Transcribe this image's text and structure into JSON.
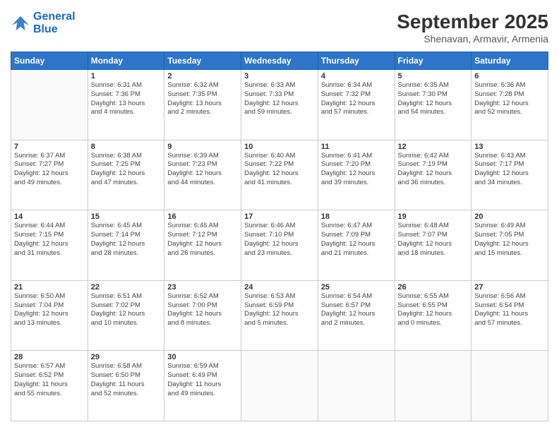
{
  "header": {
    "logo_line1": "General",
    "logo_line2": "Blue",
    "month": "September 2025",
    "location": "Shenavan, Armavir, Armenia"
  },
  "weekdays": [
    "Sunday",
    "Monday",
    "Tuesday",
    "Wednesday",
    "Thursday",
    "Friday",
    "Saturday"
  ],
  "weeks": [
    [
      {
        "day": "",
        "info": ""
      },
      {
        "day": "1",
        "info": "Sunrise: 6:31 AM\nSunset: 7:36 PM\nDaylight: 13 hours\nand 4 minutes."
      },
      {
        "day": "2",
        "info": "Sunrise: 6:32 AM\nSunset: 7:35 PM\nDaylight: 13 hours\nand 2 minutes."
      },
      {
        "day": "3",
        "info": "Sunrise: 6:33 AM\nSunset: 7:33 PM\nDaylight: 12 hours\nand 59 minutes."
      },
      {
        "day": "4",
        "info": "Sunrise: 6:34 AM\nSunset: 7:32 PM\nDaylight: 12 hours\nand 57 minutes."
      },
      {
        "day": "5",
        "info": "Sunrise: 6:35 AM\nSunset: 7:30 PM\nDaylight: 12 hours\nand 54 minutes."
      },
      {
        "day": "6",
        "info": "Sunrise: 6:36 AM\nSunset: 7:28 PM\nDaylight: 12 hours\nand 52 minutes."
      }
    ],
    [
      {
        "day": "7",
        "info": "Sunrise: 6:37 AM\nSunset: 7:27 PM\nDaylight: 12 hours\nand 49 minutes."
      },
      {
        "day": "8",
        "info": "Sunrise: 6:38 AM\nSunset: 7:25 PM\nDaylight: 12 hours\nand 47 minutes."
      },
      {
        "day": "9",
        "info": "Sunrise: 6:39 AM\nSunset: 7:23 PM\nDaylight: 12 hours\nand 44 minutes."
      },
      {
        "day": "10",
        "info": "Sunrise: 6:40 AM\nSunset: 7:22 PM\nDaylight: 12 hours\nand 41 minutes."
      },
      {
        "day": "11",
        "info": "Sunrise: 6:41 AM\nSunset: 7:20 PM\nDaylight: 12 hours\nand 39 minutes."
      },
      {
        "day": "12",
        "info": "Sunrise: 6:42 AM\nSunset: 7:19 PM\nDaylight: 12 hours\nand 36 minutes."
      },
      {
        "day": "13",
        "info": "Sunrise: 6:43 AM\nSunset: 7:17 PM\nDaylight: 12 hours\nand 34 minutes."
      }
    ],
    [
      {
        "day": "14",
        "info": "Sunrise: 6:44 AM\nSunset: 7:15 PM\nDaylight: 12 hours\nand 31 minutes."
      },
      {
        "day": "15",
        "info": "Sunrise: 6:45 AM\nSunset: 7:14 PM\nDaylight: 12 hours\nand 28 minutes."
      },
      {
        "day": "16",
        "info": "Sunrise: 6:46 AM\nSunset: 7:12 PM\nDaylight: 12 hours\nand 26 minutes."
      },
      {
        "day": "17",
        "info": "Sunrise: 6:46 AM\nSunset: 7:10 PM\nDaylight: 12 hours\nand 23 minutes."
      },
      {
        "day": "18",
        "info": "Sunrise: 6:47 AM\nSunset: 7:09 PM\nDaylight: 12 hours\nand 21 minutes."
      },
      {
        "day": "19",
        "info": "Sunrise: 6:48 AM\nSunset: 7:07 PM\nDaylight: 12 hours\nand 18 minutes."
      },
      {
        "day": "20",
        "info": "Sunrise: 6:49 AM\nSunset: 7:05 PM\nDaylight: 12 hours\nand 15 minutes."
      }
    ],
    [
      {
        "day": "21",
        "info": "Sunrise: 6:50 AM\nSunset: 7:04 PM\nDaylight: 12 hours\nand 13 minutes."
      },
      {
        "day": "22",
        "info": "Sunrise: 6:51 AM\nSunset: 7:02 PM\nDaylight: 12 hours\nand 10 minutes."
      },
      {
        "day": "23",
        "info": "Sunrise: 6:52 AM\nSunset: 7:00 PM\nDaylight: 12 hours\nand 8 minutes."
      },
      {
        "day": "24",
        "info": "Sunrise: 6:53 AM\nSunset: 6:59 PM\nDaylight: 12 hours\nand 5 minutes."
      },
      {
        "day": "25",
        "info": "Sunrise: 6:54 AM\nSunset: 6:57 PM\nDaylight: 12 hours\nand 2 minutes."
      },
      {
        "day": "26",
        "info": "Sunrise: 6:55 AM\nSunset: 6:55 PM\nDaylight: 12 hours\nand 0 minutes."
      },
      {
        "day": "27",
        "info": "Sunrise: 6:56 AM\nSunset: 6:54 PM\nDaylight: 11 hours\nand 57 minutes."
      }
    ],
    [
      {
        "day": "28",
        "info": "Sunrise: 6:57 AM\nSunset: 6:52 PM\nDaylight: 11 hours\nand 55 minutes."
      },
      {
        "day": "29",
        "info": "Sunrise: 6:58 AM\nSunset: 6:50 PM\nDaylight: 11 hours\nand 52 minutes."
      },
      {
        "day": "30",
        "info": "Sunrise: 6:59 AM\nSunset: 6:49 PM\nDaylight: 11 hours\nand 49 minutes."
      },
      {
        "day": "",
        "info": ""
      },
      {
        "day": "",
        "info": ""
      },
      {
        "day": "",
        "info": ""
      },
      {
        "day": "",
        "info": ""
      }
    ]
  ]
}
